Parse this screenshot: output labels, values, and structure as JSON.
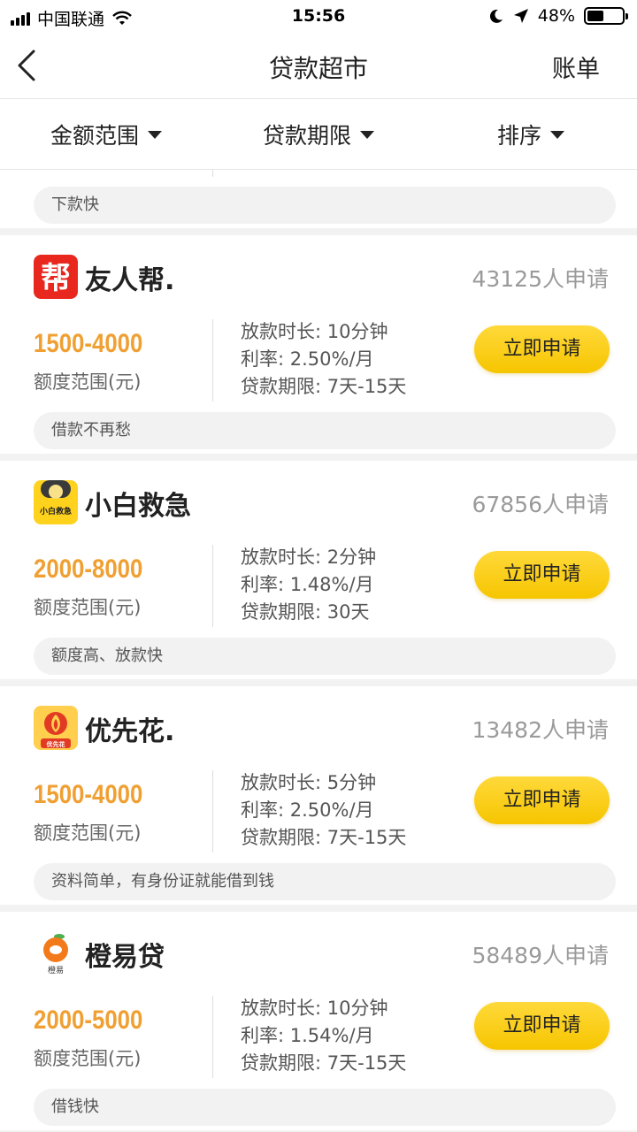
{
  "status_bar": {
    "carrier": "中国联通",
    "time": "15:56",
    "battery": "48%",
    "battery_level": 0.48
  },
  "nav": {
    "title": "贷款超市",
    "right_label": "账单"
  },
  "filters": [
    {
      "label": "金额范围"
    },
    {
      "label": "贷款期限"
    },
    {
      "label": "排序"
    }
  ],
  "partial_item": {
    "tag": "下款快"
  },
  "amount_label": "额度范围(元)",
  "apply_label": "立即申请",
  "products": [
    {
      "name": "友人帮.",
      "logo": "bang-logo-icon",
      "applicants": "43125人申请",
      "amount": "1500-4000",
      "loan_time": "放款时长: 10分钟",
      "rate": "利率: 2.50%/月",
      "term": "贷款期限: 7天-15天",
      "tag": "借款不再愁"
    },
    {
      "name": "小白救急",
      "logo": "xiaobai-logo-icon",
      "applicants": "67856人申请",
      "amount": "2000-8000",
      "loan_time": "放款时长: 2分钟",
      "rate": "利率: 1.48%/月",
      "term": "贷款期限: 30天",
      "tag": "额度高、放款快"
    },
    {
      "name": "优先花.",
      "logo": "youxianhua-logo-icon",
      "applicants": "13482人申请",
      "amount": "1500-4000",
      "loan_time": "放款时长: 5分钟",
      "rate": "利率: 2.50%/月",
      "term": "贷款期限: 7天-15天",
      "tag": "资料简单，有身份证就能借到钱"
    },
    {
      "name": "橙易贷",
      "logo": "chengyidai-logo-icon",
      "applicants": "58489人申请",
      "amount": "2000-5000",
      "loan_time": "放款时长: 10分钟",
      "rate": "利率: 1.54%/月",
      "term": "贷款期限: 7天-15天",
      "tag": "借钱快"
    }
  ],
  "logo_text": {
    "bang": "帮",
    "xiaobai": "小白救急",
    "youxianhua": "优先花",
    "chengyi": "橙易"
  },
  "colors": {
    "accent_yellow": "#f6c500",
    "amount_orange": "#f0a032",
    "tag_bg": "#f2f2f2"
  }
}
